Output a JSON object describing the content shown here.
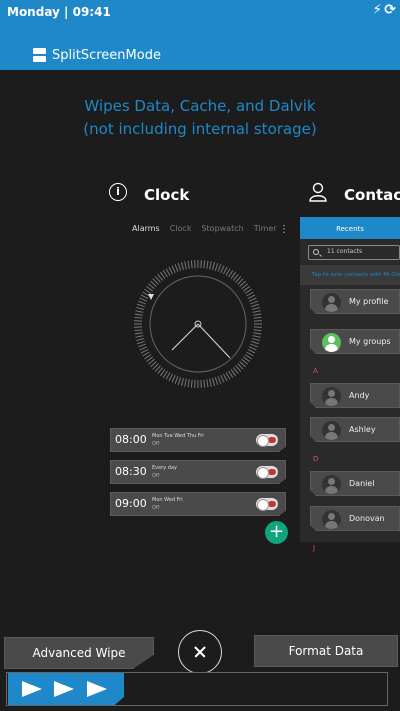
{
  "status_bar": {
    "time_text": "Monday | 09:41",
    "icons": [
      "flash-icon",
      "sync-icon"
    ]
  },
  "app": {
    "title": "SplitScreenMode",
    "icon": "split-screen-icon"
  },
  "warning": {
    "line1": "Wipes Data, Cache, and Dalvik",
    "line2": "(not including internal storage)"
  },
  "clock": {
    "title": "Clock",
    "tabs": [
      "Alarms",
      "Clock",
      "Stopwatch",
      "Timer"
    ],
    "alarms": [
      {
        "time": "08:00",
        "days": "Mon Tue Wed Thu Fri",
        "state": "Off"
      },
      {
        "time": "08:30",
        "days": "Every day",
        "state": "Off"
      },
      {
        "time": "09:00",
        "days": "Mon Wed Fri",
        "state": "Off"
      }
    ],
    "add_label": "+"
  },
  "contacts": {
    "title": "Contacts",
    "tab": "Recents",
    "search_placeholder": "11 contacts",
    "sync_banner": "Tap to sync contacts with Mi Cloud",
    "items": [
      {
        "name": "My profile"
      },
      {
        "name": "My groups"
      },
      {
        "section": "A"
      },
      {
        "name": "Andy"
      },
      {
        "name": "Ashley"
      },
      {
        "section": "D"
      },
      {
        "name": "Daniel"
      },
      {
        "name": "Donovan"
      },
      {
        "section": "J"
      }
    ]
  },
  "bottom": {
    "left_button": "Advanced Wipe",
    "right_button": "Format Data"
  },
  "colors": {
    "accent": "#1e88c9",
    "background": "#1c1c1c",
    "fab": "#12a37f",
    "section_letter": "#e05050"
  }
}
